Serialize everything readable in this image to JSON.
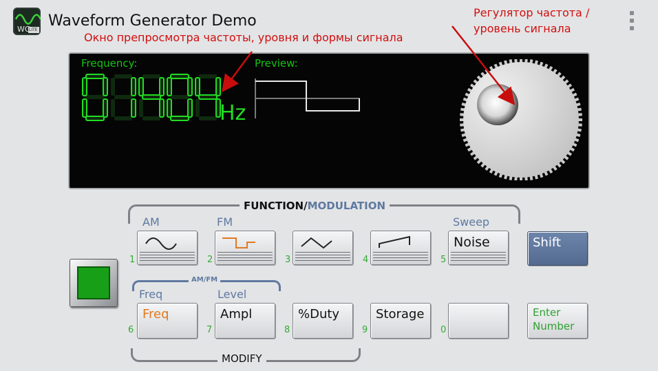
{
  "app": {
    "title": "Waveform Generator Demo",
    "icon_badge": "LITE",
    "icon_letters": "WG"
  },
  "annotations": {
    "preview_window": "Окно препросмотра частоты, уровня и формы сигнала",
    "knob_line1": "Регулятор частота /",
    "knob_line2": "уровень сигнала"
  },
  "display": {
    "frequency_label": "Frequency:",
    "frequency_value": "1404",
    "frequency_unit": "Hz",
    "preview_label": "Preview:",
    "preview_waveform": "square"
  },
  "controls": {
    "function_title": "FUNCTION/",
    "modulation_title": "MODULATION",
    "am_label": "AM",
    "fm_label": "FM",
    "sweep_label": "Sweep",
    "amfm_label": "AM/FM",
    "freq_group_label": "Freq",
    "level_group_label": "Level",
    "modify_title": "MODIFY",
    "row1": [
      {
        "num": "1",
        "icon": "sine-wave-icon"
      },
      {
        "num": "2",
        "icon": "square-wave-icon"
      },
      {
        "num": "3",
        "icon": "triangle-wave-icon"
      },
      {
        "num": "4",
        "icon": "sawtooth-wave-icon"
      },
      {
        "num": "5",
        "label": "Noise"
      }
    ],
    "shift_label": "Shift",
    "row2": [
      {
        "num": "6",
        "label": "Freq"
      },
      {
        "num": "7",
        "label": "Ampl"
      },
      {
        "num": "8",
        "label": "%Duty"
      },
      {
        "num": "9",
        "label": "Storage"
      },
      {
        "num": "0",
        "label": ""
      }
    ],
    "enter_label_1": "Enter",
    "enter_label_2": "Number"
  },
  "colors": {
    "lcd_green": "#22dd22",
    "annotation_red": "#d10e0e",
    "shift_blue": "#5d7398",
    "active_orange": "#e07a1f",
    "group_blue": "#5e79a0"
  }
}
